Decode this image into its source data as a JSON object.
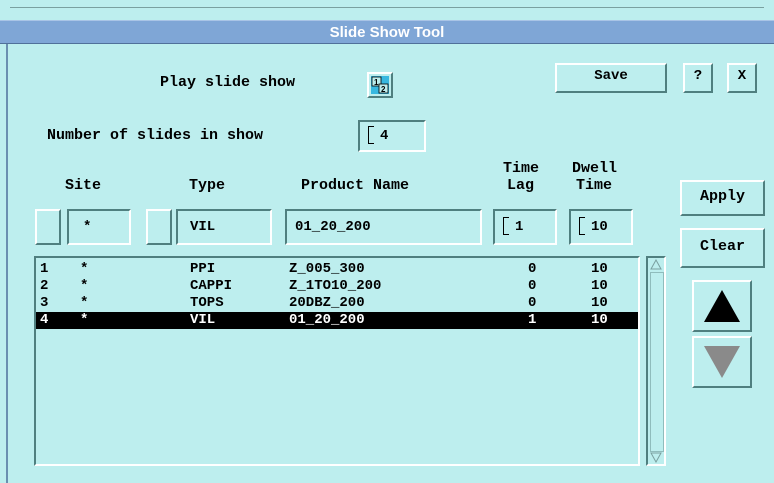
{
  "window": {
    "title": "Slide Show Tool"
  },
  "play": {
    "label": "Play slide show",
    "icon_text": "1/2"
  },
  "buttons": {
    "save": "Save",
    "help": "?",
    "close": "X",
    "apply": "Apply",
    "clear": "Clear"
  },
  "num_slides": {
    "label": "Number of slides in show",
    "value": "4"
  },
  "columns": {
    "site": "Site",
    "type": "Type",
    "product": "Product Name",
    "time_lag_1": "Time",
    "time_lag_2": "Lag",
    "dwell_1": "Dwell",
    "dwell_2": "Time"
  },
  "inputs": {
    "site": "*",
    "type": "VIL",
    "product": "01_20_200",
    "time_lag": "1",
    "dwell": "10"
  },
  "rows": [
    {
      "num": "1",
      "site": "*",
      "type": "PPI",
      "product": "Z_005_300",
      "lag": "0",
      "dwell": "10",
      "selected": false
    },
    {
      "num": "2",
      "site": "*",
      "type": "CAPPI",
      "product": "Z_1TO10_200",
      "lag": "0",
      "dwell": "10",
      "selected": false
    },
    {
      "num": "3",
      "site": "*",
      "type": "TOPS",
      "product": "20DBZ_200",
      "lag": "0",
      "dwell": "10",
      "selected": false
    },
    {
      "num": "4",
      "site": "*",
      "type": "VIL",
      "product": "01_20_200",
      "lag": "1",
      "dwell": "10",
      "selected": true
    }
  ],
  "colors": {
    "background": "#bdeeee",
    "titlebar": "#7fa6d6",
    "selection": "#000000",
    "arrow_disabled": "#8a8a8a"
  }
}
